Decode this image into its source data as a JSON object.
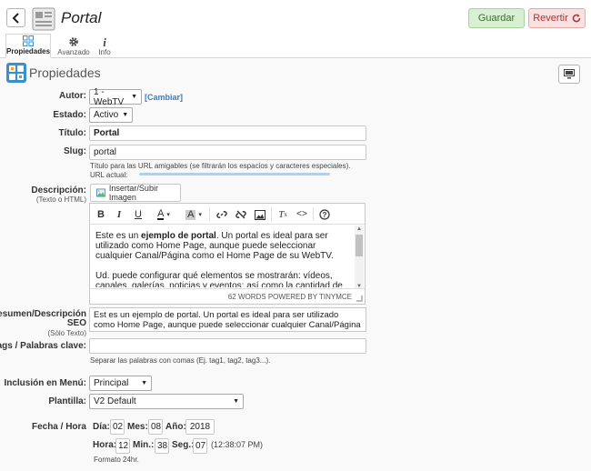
{
  "header": {
    "title": "Portal",
    "save_label": "Guardar",
    "revert_label": "Revertir"
  },
  "tabs": [
    {
      "label": "Propiedades",
      "icon": "properties-icon",
      "active": true
    },
    {
      "label": "Avanzado",
      "icon": "gear-icon",
      "active": false
    },
    {
      "label": "Info",
      "icon": "info-icon",
      "active": false
    }
  ],
  "section": {
    "title": "Propiedades"
  },
  "form": {
    "autor": {
      "label": "Autor:",
      "value": "1 - WebTV",
      "change_link": "[Cambiar]"
    },
    "estado": {
      "label": "Estado:",
      "value": "Activo"
    },
    "titulo": {
      "label": "Título:",
      "value": "Portal"
    },
    "slug": {
      "label": "Slug:",
      "value": "portal",
      "help": "Título para las URL amigables (se filtrarán los espacios y caracteres especiales).",
      "url_label": "URL actual:"
    },
    "descripcion": {
      "label": "Descripción:",
      "sublabel": "(Texto o HTML)",
      "insert_label": "Insertar/Subir Imagen",
      "p1_prefix": "Este es un ",
      "p1_bold": "ejemplo de portal",
      "p1_suffix": ". Un portal es ideal para ser utilizado como Home Page, aunque puede seleccionar cualquier Canal/Página como el Home Page de su WebTV.",
      "p2": "Ud. puede configurar qué elementos se mostrarán: vídeos, canales, galerías, noticias y eventos; así como la cantidad de cada uno.",
      "status": "62 WORDS POWERED BY TINYMCE"
    },
    "resumen": {
      "label": "Resumen/Descripción",
      "label2": "SEO",
      "sublabel": "(Sólo Texto)",
      "value": "Est es un ejemplo de portal. Un portal es ideal para ser utilizado como Home Page, aunque puede seleccionar cualquier Canal/Página como el Home Page"
    },
    "tags": {
      "label": "Tags / Palabras clave:",
      "value": "",
      "help": "Separar las palabras con comas (Ej. tag1, tag2, tag3...)."
    },
    "menu": {
      "label": "Inclusión en Menú:",
      "value": "Principal"
    },
    "plantilla": {
      "label": "Plantilla:",
      "value": "V2 Default"
    },
    "fecha": {
      "label": "Fecha / Hora",
      "dia_label": "Día:",
      "dia": "02",
      "mes_label": "Mes:",
      "mes": "08",
      "anio_label": "Año:",
      "anio": "2018",
      "hora_label": "Hora:",
      "hora": "12",
      "min_label": "Min.:",
      "min": "38",
      "seg_label": "Seg.:",
      "seg": "07",
      "full_time": "(12:38:07 PM)",
      "format_note": "Formato 24hr."
    }
  },
  "colors": {
    "save_bg": "#d8f0d2",
    "revert_bg": "#fbe0e0",
    "link": "#3a7bc8",
    "section_icon_accent": "#3b8fd0"
  }
}
